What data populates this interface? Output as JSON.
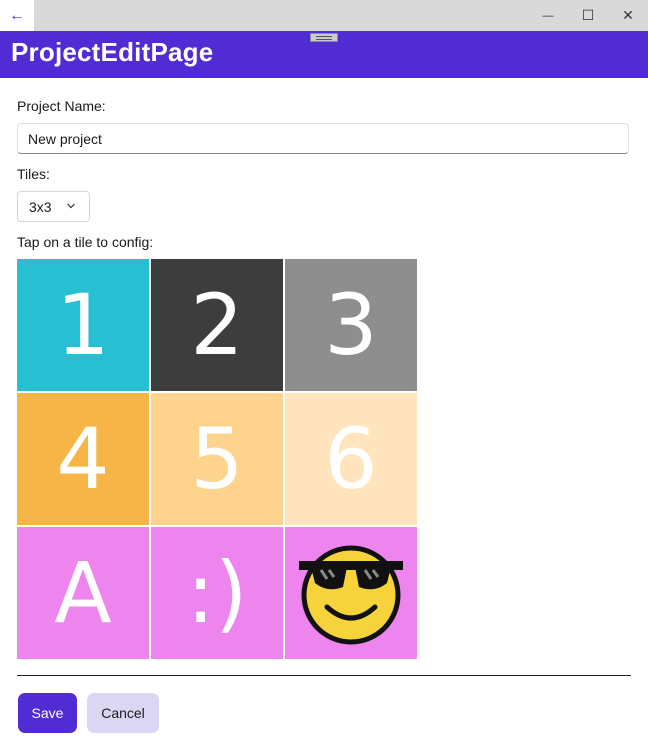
{
  "window": {
    "back_glyph": "←",
    "minimize_glyph": "—",
    "maximize_glyph": "☐",
    "close_glyph": "✕"
  },
  "header": {
    "title": "ProjectEditPage",
    "color": "#512bd4"
  },
  "form": {
    "project_name_label": "Project Name:",
    "project_name_value": "New project",
    "tiles_label": "Tiles:",
    "tiles_value": "3x3",
    "tap_label": "Tap on a tile to config:"
  },
  "tiles": [
    {
      "label": "1",
      "color": "#27c0d3"
    },
    {
      "label": "2",
      "color": "#3d3d3d"
    },
    {
      "label": "3",
      "color": "#8e8e8e"
    },
    {
      "label": "4",
      "color": "#f7b548"
    },
    {
      "label": "5",
      "color": "#fed38e"
    },
    {
      "label": "6",
      "color": "#ffe4be"
    },
    {
      "label": "A",
      "color": "#ee84ee"
    },
    {
      "label": ":)",
      "color": "#ee84ee"
    },
    {
      "label": "",
      "icon": "sunglasses-emoji-icon",
      "color": "#ee84ee"
    }
  ],
  "actions": {
    "save": "Save",
    "cancel": "Cancel"
  }
}
